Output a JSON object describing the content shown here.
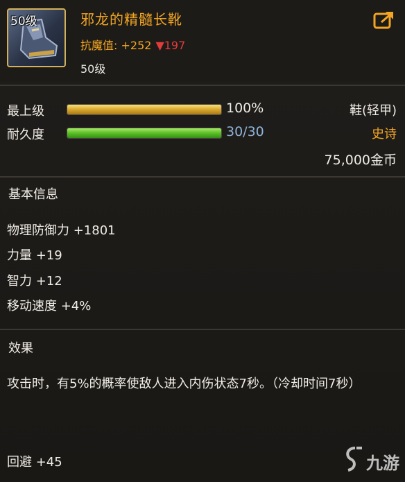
{
  "item": {
    "icon_level": "50级",
    "name": "邪龙的精髓长靴",
    "stat_label": "抗魔值: ",
    "stat_value": "+252",
    "stat_compare": "▼197",
    "required_level": "50级",
    "icon": "boot-armor-icon"
  },
  "bars": {
    "upgrade": {
      "label": "最上级",
      "value_text": "100%",
      "fraction": 1.0
    },
    "durability": {
      "label": "耐久度",
      "value_text": "30/30",
      "fraction": 1.0
    }
  },
  "meta": {
    "type": "鞋(轻甲)",
    "rarity": "史诗",
    "price": "75,000金币"
  },
  "basic": {
    "title": "基本信息",
    "attributes": [
      "物理防御力 +1801",
      "力量 +19",
      "智力 +12",
      "移动速度 +4%"
    ]
  },
  "effect": {
    "title": "效果",
    "text": "攻击时，有5%的概率使敌人进入内伤状态7秒。（冷却时间7秒）",
    "bonus": "回避 +45"
  },
  "watermark": {
    "text": "九游"
  },
  "colors": {
    "gold": "#f2a523",
    "red": "#e23b3b",
    "rarity": "#f2a523",
    "durability_text": "#8fb4da"
  }
}
